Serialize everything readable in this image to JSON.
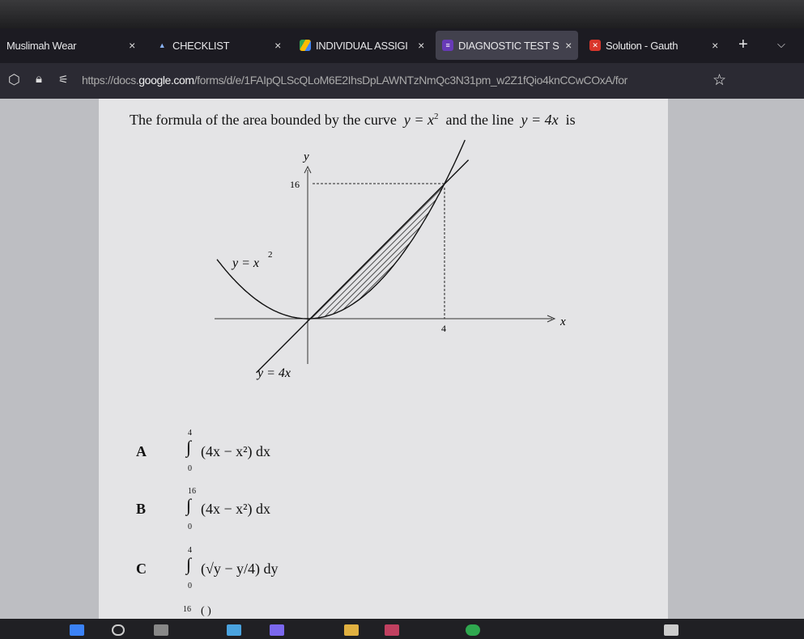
{
  "browser": {
    "tabs": [
      {
        "label": "Muslimah Wear",
        "icon": "none",
        "active": false
      },
      {
        "label": "CHECKLIST",
        "icon": "triangle-icon",
        "active": false
      },
      {
        "label": "INDIVIDUAL ASSIGI",
        "icon": "google-drive-icon",
        "active": false
      },
      {
        "label": "DIAGNOSTIC TEST S",
        "icon": "google-forms-icon",
        "active": true
      },
      {
        "label": "Solution - Gauth",
        "icon": "gauth-icon",
        "active": false
      }
    ],
    "new_tab": "+",
    "close": "×",
    "url_prefix": "https://docs.",
    "url_domain": "google.com",
    "url_path": "/forms/d/e/1FAIpQLScQLoM6E2IhsDpLAWNTzNmQc3N31pm_w2Z1fQio4knCCwCOxA/for"
  },
  "question": {
    "text_before": "The formula of the area bounded by the curve",
    "curve": "y = x",
    "curve_exp": "2",
    "text_mid": "and the line",
    "line": "y = 4x",
    "text_after": "is"
  },
  "graph": {
    "y_axis_label": "y",
    "x_axis_label": "x",
    "y_tick": "16",
    "x_tick": "4",
    "curve_label": "y = x",
    "curve_label_exp": "2",
    "line_label": "y = 4x"
  },
  "options": [
    {
      "letter": "A",
      "upper": "4",
      "lower": "0",
      "expr": "(4x − x²) dx"
    },
    {
      "letter": "B",
      "upper": "16",
      "lower": "0",
      "expr": "(4x − x²) dx"
    },
    {
      "letter": "C",
      "upper": "4",
      "lower": "0",
      "expr": "(√y − y/4) dy"
    },
    {
      "letter": "",
      "upper": "16",
      "lower": "",
      "expr": "(             )"
    }
  ]
}
